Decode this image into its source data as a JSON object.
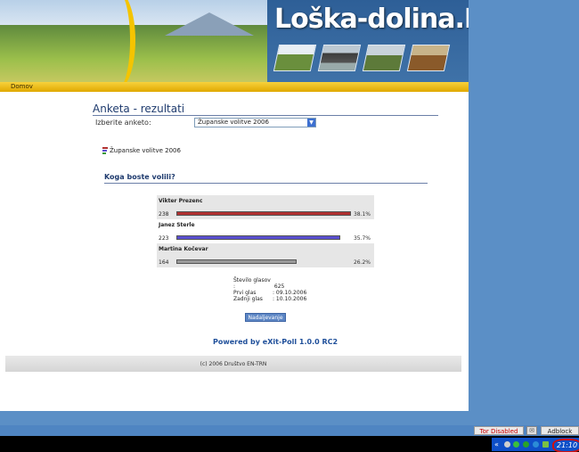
{
  "site": {
    "title": "Loška-dolina.NET"
  },
  "nav": {
    "home": "Domov"
  },
  "poll": {
    "heading": "Anketa - rezultati",
    "select_label": "Izberite anketo:",
    "selected": "Županske volitve 2006",
    "poll_name": "Županske volitve 2006",
    "question": "Koga boste volili?",
    "candidates": [
      {
        "name": "Vikter Prezenc",
        "votes": "238",
        "percent": "38.1%",
        "fraction": 0.381,
        "color": "#b03030"
      },
      {
        "name": "Janez Sterle",
        "votes": "223",
        "percent": "35.7%",
        "fraction": 0.357,
        "color": "#5a4fd0"
      },
      {
        "name": "Martina Kočevar",
        "votes": "164",
        "percent": "26.2%",
        "fraction": 0.262,
        "color": "#9a9a9a"
      }
    ],
    "stats": {
      "total_label": "Število glasov :",
      "total_value": "625",
      "first_label": "Prvi glas",
      "first_value": ": 09.10.2006",
      "last_label": "Zadnji glas",
      "last_value": ": 10.10.2006"
    },
    "continue_label": "Nadaljevanje",
    "powered_by": "Powered by eXit-Poll 1.0.0 RC2"
  },
  "footer": {
    "text": "(c) 2006 Društvo EN-TRN"
  },
  "status": {
    "tor": "Tor Disabled",
    "adblock": "Adblock"
  },
  "taskbar": {
    "expand": "«",
    "clock": "21:10"
  },
  "colors": {
    "accent": "#f4c400",
    "header_blue": "#1f3b6e",
    "desktop": "#5b8fc6"
  }
}
